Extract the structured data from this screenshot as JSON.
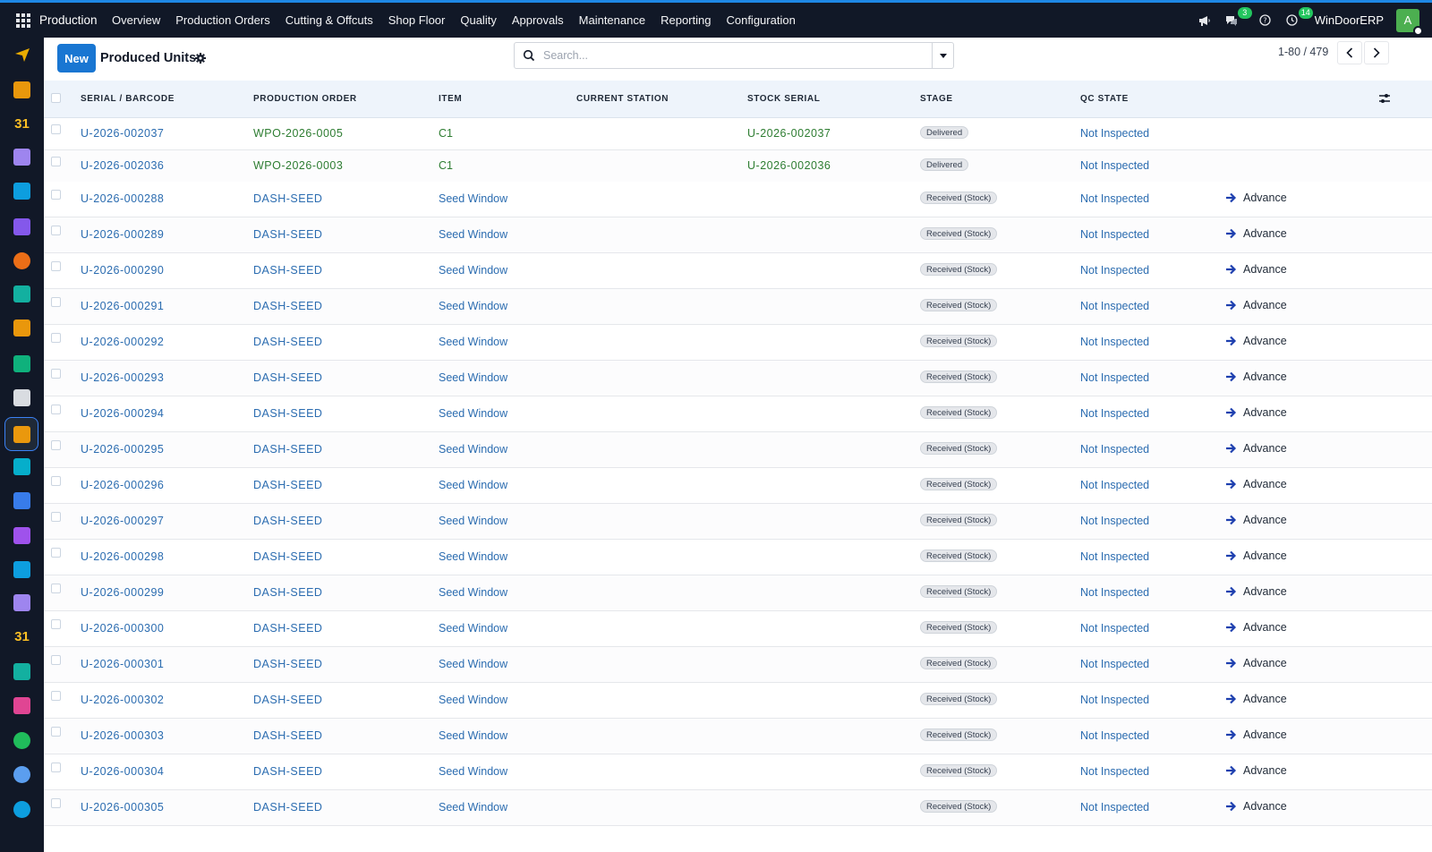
{
  "navbar": {
    "app_name": "Production",
    "menu": [
      "Overview",
      "Production Orders",
      "Cutting & Offcuts",
      "Shop Floor",
      "Quality",
      "Approvals",
      "Maintenance",
      "Reporting",
      "Configuration"
    ],
    "messages_count": "3",
    "activities_count": "14",
    "company": "WinDoorERP",
    "user_initial": "A"
  },
  "sidebar": {
    "apps": [
      {
        "icon": "paper-plane-icon",
        "color": "#f5b400"
      },
      {
        "icon": "bar-chart-icon",
        "color": "#f59e0b"
      },
      {
        "icon": "calendar-31-icon",
        "color": "#fbbf24",
        "label": "31"
      },
      {
        "icon": "people-icon",
        "color": "#a78bfa"
      },
      {
        "icon": "sales-icon",
        "color": "#0ea5e9"
      },
      {
        "icon": "mail-icon",
        "color": "#8b5cf6"
      },
      {
        "icon": "chat-bubble-icon",
        "color": "#f97316"
      },
      {
        "icon": "ribbon-icon",
        "color": "#14b8a6"
      },
      {
        "icon": "building-chart-icon",
        "color": "#f59e0b"
      },
      {
        "icon": "contact-card-icon",
        "color": "#10b981"
      },
      {
        "icon": "box-icon",
        "color": "#e5e7eb"
      },
      {
        "icon": "production-app-icon",
        "color": "#f59e0b",
        "active": true
      },
      {
        "icon": "check-icon",
        "color": "#06b6d4"
      },
      {
        "icon": "book-icon",
        "color": "#3b82f6"
      },
      {
        "icon": "cube-icon",
        "color": "#a855f7"
      },
      {
        "icon": "invoice-icon",
        "color": "#0ea5e9"
      },
      {
        "icon": "team-icon",
        "color": "#a78bfa"
      },
      {
        "icon": "calendar-31-icon",
        "color": "#fbbf24",
        "label": "31"
      },
      {
        "icon": "sign-icon",
        "color": "#14b8a6"
      },
      {
        "icon": "dashboard-icon",
        "color": "#ec4899"
      },
      {
        "icon": "whatsapp-icon",
        "color": "#22c55e"
      },
      {
        "icon": "globe-icon",
        "color": "#60a5fa"
      },
      {
        "icon": "wave-icon",
        "color": "#0ea5e9"
      }
    ]
  },
  "control_panel": {
    "new_label": "New",
    "title": "Produced Units",
    "search_placeholder": "Search...",
    "pager": "1-80 / 479"
  },
  "table": {
    "columns": [
      "SERIAL / BARCODE",
      "PRODUCTION ORDER",
      "ITEM",
      "CURRENT STATION",
      "STOCK SERIAL",
      "STAGE",
      "QC STATE"
    ],
    "rows": [
      {
        "serial": "U-2026-002037",
        "order": "WPO-2026-0005",
        "item": "C1",
        "station": "",
        "stock_serial": "U-2026-002037",
        "stage": "Delivered",
        "qc": "Not Inspected",
        "action": ""
      },
      {
        "serial": "U-2026-002036",
        "order": "WPO-2026-0003",
        "item": "C1",
        "station": "",
        "stock_serial": "U-2026-002036",
        "stage": "Delivered",
        "qc": "Not Inspected",
        "action": ""
      },
      {
        "serial": "U-2026-000288",
        "order": "DASH-SEED",
        "item": "Seed Window",
        "station": "",
        "stock_serial": "",
        "stage": "Received (Stock)",
        "qc": "Not Inspected",
        "action": "Advance"
      },
      {
        "serial": "U-2026-000289",
        "order": "DASH-SEED",
        "item": "Seed Window",
        "station": "",
        "stock_serial": "",
        "stage": "Received (Stock)",
        "qc": "Not Inspected",
        "action": "Advance"
      },
      {
        "serial": "U-2026-000290",
        "order": "DASH-SEED",
        "item": "Seed Window",
        "station": "",
        "stock_serial": "",
        "stage": "Received (Stock)",
        "qc": "Not Inspected",
        "action": "Advance"
      },
      {
        "serial": "U-2026-000291",
        "order": "DASH-SEED",
        "item": "Seed Window",
        "station": "",
        "stock_serial": "",
        "stage": "Received (Stock)",
        "qc": "Not Inspected",
        "action": "Advance"
      },
      {
        "serial": "U-2026-000292",
        "order": "DASH-SEED",
        "item": "Seed Window",
        "station": "",
        "stock_serial": "",
        "stage": "Received (Stock)",
        "qc": "Not Inspected",
        "action": "Advance"
      },
      {
        "serial": "U-2026-000293",
        "order": "DASH-SEED",
        "item": "Seed Window",
        "station": "",
        "stock_serial": "",
        "stage": "Received (Stock)",
        "qc": "Not Inspected",
        "action": "Advance"
      },
      {
        "serial": "U-2026-000294",
        "order": "DASH-SEED",
        "item": "Seed Window",
        "station": "",
        "stock_serial": "",
        "stage": "Received (Stock)",
        "qc": "Not Inspected",
        "action": "Advance"
      },
      {
        "serial": "U-2026-000295",
        "order": "DASH-SEED",
        "item": "Seed Window",
        "station": "",
        "stock_serial": "",
        "stage": "Received (Stock)",
        "qc": "Not Inspected",
        "action": "Advance"
      },
      {
        "serial": "U-2026-000296",
        "order": "DASH-SEED",
        "item": "Seed Window",
        "station": "",
        "stock_serial": "",
        "stage": "Received (Stock)",
        "qc": "Not Inspected",
        "action": "Advance"
      },
      {
        "serial": "U-2026-000297",
        "order": "DASH-SEED",
        "item": "Seed Window",
        "station": "",
        "stock_serial": "",
        "stage": "Received (Stock)",
        "qc": "Not Inspected",
        "action": "Advance"
      },
      {
        "serial": "U-2026-000298",
        "order": "DASH-SEED",
        "item": "Seed Window",
        "station": "",
        "stock_serial": "",
        "stage": "Received (Stock)",
        "qc": "Not Inspected",
        "action": "Advance"
      },
      {
        "serial": "U-2026-000299",
        "order": "DASH-SEED",
        "item": "Seed Window",
        "station": "",
        "stock_serial": "",
        "stage": "Received (Stock)",
        "qc": "Not Inspected",
        "action": "Advance"
      },
      {
        "serial": "U-2026-000300",
        "order": "DASH-SEED",
        "item": "Seed Window",
        "station": "",
        "stock_serial": "",
        "stage": "Received (Stock)",
        "qc": "Not Inspected",
        "action": "Advance"
      },
      {
        "serial": "U-2026-000301",
        "order": "DASH-SEED",
        "item": "Seed Window",
        "station": "",
        "stock_serial": "",
        "stage": "Received (Stock)",
        "qc": "Not Inspected",
        "action": "Advance"
      },
      {
        "serial": "U-2026-000302",
        "order": "DASH-SEED",
        "item": "Seed Window",
        "station": "",
        "stock_serial": "",
        "stage": "Received (Stock)",
        "qc": "Not Inspected",
        "action": "Advance"
      },
      {
        "serial": "U-2026-000303",
        "order": "DASH-SEED",
        "item": "Seed Window",
        "station": "",
        "stock_serial": "",
        "stage": "Received (Stock)",
        "qc": "Not Inspected",
        "action": "Advance"
      },
      {
        "serial": "U-2026-000304",
        "order": "DASH-SEED",
        "item": "Seed Window",
        "station": "",
        "stock_serial": "",
        "stage": "Received (Stock)",
        "qc": "Not Inspected",
        "action": "Advance"
      },
      {
        "serial": "U-2026-000305",
        "order": "DASH-SEED",
        "item": "Seed Window",
        "station": "",
        "stock_serial": "",
        "stage": "Received (Stock)",
        "qc": "Not Inspected",
        "action": "Advance"
      }
    ]
  },
  "colors": {
    "navbar_bg": "#111827",
    "accent": "#1976d2",
    "link": "#2b6cb0",
    "success_link": "#2e7d32",
    "header_bg": "#eef4fb"
  }
}
